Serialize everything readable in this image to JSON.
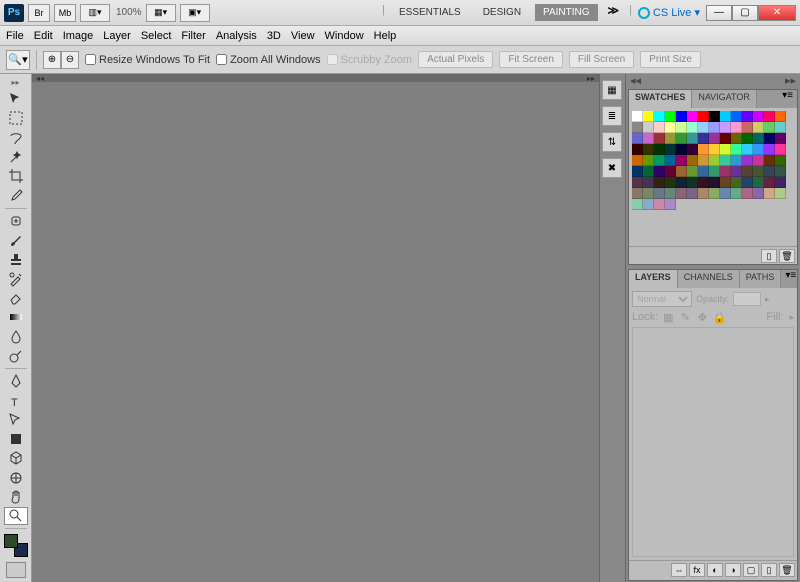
{
  "titlebar": {
    "logo": "Ps",
    "br": "Br",
    "mb": "Mb",
    "zoom": "100%",
    "workspaces": [
      "ESSENTIALS",
      "DESIGN",
      "PAINTING"
    ],
    "active_workspace": 2,
    "expand": "≫",
    "cslive": "CS Live ▾"
  },
  "menu": [
    "File",
    "Edit",
    "Image",
    "Layer",
    "Select",
    "Filter",
    "Analysis",
    "3D",
    "View",
    "Window",
    "Help"
  ],
  "options": {
    "resize_label": "Resize Windows To Fit",
    "zoom_all_label": "Zoom All Windows",
    "scrubby_label": "Scrubby Zoom",
    "btns": [
      "Actual Pixels",
      "Fit Screen",
      "Fill Screen",
      "Print Size"
    ]
  },
  "tools": [
    "move",
    "marquee",
    "lasso",
    "wand",
    "crop",
    "eyedropper",
    "healing",
    "brush",
    "stamp",
    "history",
    "eraser",
    "gradient",
    "blur",
    "dodge",
    "pen",
    "type",
    "path",
    "shape",
    "3d",
    "3dcam",
    "hand",
    "zoom"
  ],
  "active_tool": "zoom",
  "fg_color": "#2a4a2a",
  "bg_color": "#1a2a4a",
  "dock_icons": [
    "⊞",
    "≡",
    "⇅",
    "✕"
  ],
  "panel1": {
    "tabs": [
      "SWATCHES",
      "NAVIGATOR"
    ],
    "active": 0
  },
  "swatch_colors": [
    "#fff",
    "#ff0",
    "#0ff",
    "#0f0",
    "#00f",
    "#f0f",
    "#f00",
    "#000",
    "#0cf",
    "#06f",
    "#60f",
    "#c0f",
    "#f06",
    "#f60",
    "#888",
    "#ccc",
    "#fcc",
    "#ff9",
    "#cf9",
    "#9fc",
    "#9cf",
    "#99f",
    "#c9f",
    "#f9c",
    "#c66",
    "#cc6",
    "#6c6",
    "#6cc",
    "#66c",
    "#c6c",
    "#933",
    "#993",
    "#393",
    "#399",
    "#339",
    "#939",
    "#600",
    "#660",
    "#060",
    "#066",
    "#006",
    "#606",
    "#300",
    "#330",
    "#030",
    "#033",
    "#003",
    "#303",
    "#f93",
    "#fc3",
    "#cf3",
    "#3f9",
    "#3cf",
    "#39f",
    "#93f",
    "#f39",
    "#c60",
    "#690",
    "#096",
    "#069",
    "#906",
    "#960",
    "#c93",
    "#9c3",
    "#3c9",
    "#39c",
    "#93c",
    "#c39",
    "#630",
    "#360",
    "#036",
    "#063",
    "#306",
    "#603",
    "#963",
    "#693",
    "#369",
    "#396",
    "#936",
    "#639",
    "#543",
    "#453",
    "#345",
    "#354",
    "#534",
    "#435",
    "#321",
    "#231",
    "#123",
    "#132",
    "#312",
    "#213",
    "#642",
    "#462",
    "#246",
    "#264",
    "#624",
    "#426",
    "#876",
    "#786",
    "#678",
    "#687",
    "#867",
    "#768",
    "#a86",
    "#8a6",
    "#68a",
    "#6a8",
    "#a68",
    "#86a",
    "#ca8",
    "#ac8",
    "#8ca",
    "#8ac",
    "#c8a",
    "#a8c"
  ],
  "panel2": {
    "tabs": [
      "LAYERS",
      "CHANNELS",
      "PATHS"
    ],
    "active": 0,
    "blend": "Normal",
    "opacity_label": "Opacity:",
    "lock_label": "Lock:",
    "fill_label": "Fill:"
  }
}
